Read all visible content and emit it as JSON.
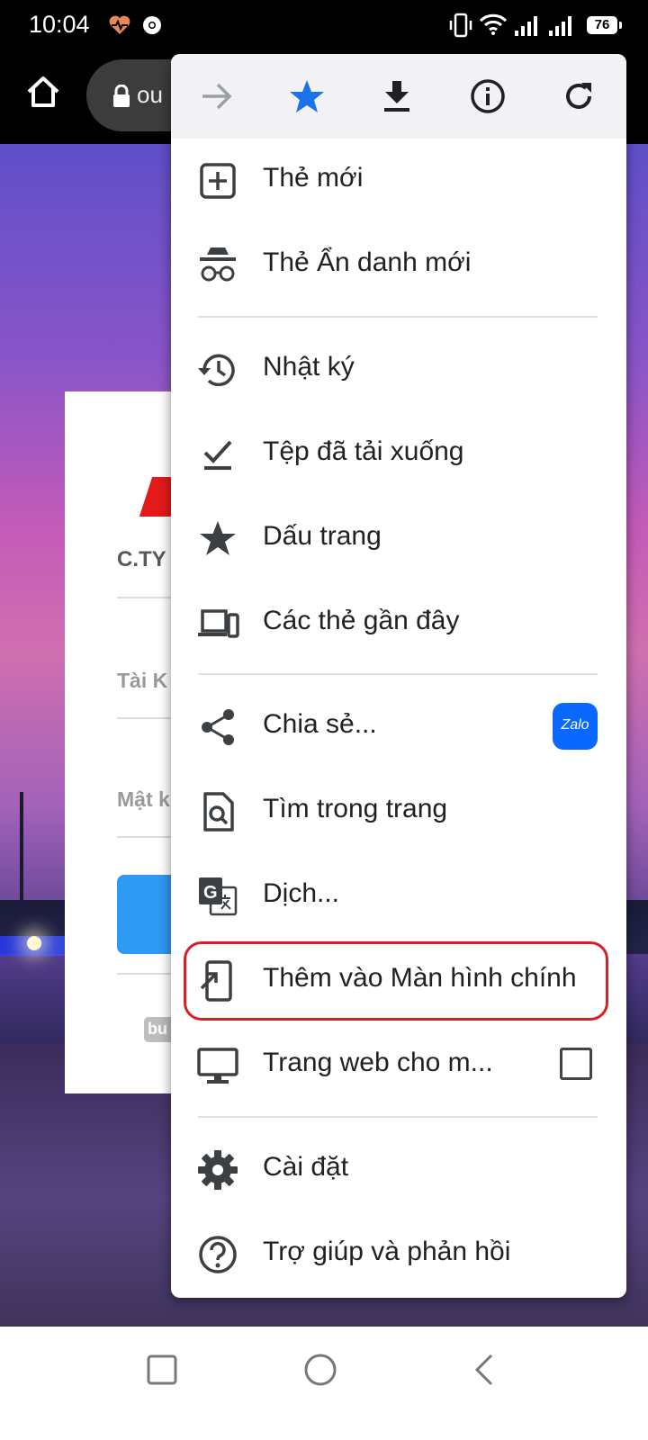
{
  "status_bar": {
    "time": "10:04",
    "battery": "76"
  },
  "toolbar": {
    "url_fragment": "ou"
  },
  "login_card": {
    "company": "C.TY",
    "username_label": "Tài K",
    "password_label": "Mật k",
    "badge_text": "bu"
  },
  "menu": {
    "top_icons": [
      "forward-icon",
      "bookmark-star-icon",
      "download-icon",
      "info-icon",
      "refresh-icon"
    ],
    "items": [
      {
        "label": "Thẻ mới",
        "icon": "new-tab-icon"
      },
      {
        "label": "Thẻ Ẩn danh mới",
        "icon": "incognito-icon"
      },
      {
        "label": "Nhật ký",
        "icon": "history-icon"
      },
      {
        "label": "Tệp đã tải xuống",
        "icon": "downloads-icon"
      },
      {
        "label": "Dấu trang",
        "icon": "bookmarks-icon"
      },
      {
        "label": "Các thẻ gần đây",
        "icon": "recent-tabs-icon"
      },
      {
        "label": "Chia sẻ...",
        "icon": "share-icon",
        "extra": "Zalo"
      },
      {
        "label": "Tìm trong trang",
        "icon": "find-in-page-icon"
      },
      {
        "label": "Dịch...",
        "icon": "translate-icon"
      },
      {
        "label": "Thêm vào Màn hình chính",
        "icon": "add-to-homescreen-icon"
      },
      {
        "label": "Trang web cho m...",
        "icon": "desktop-site-icon"
      },
      {
        "label": "Cài đặt",
        "icon": "settings-icon"
      },
      {
        "label": "Trợ giúp và phản hồi",
        "icon": "help-icon"
      }
    ]
  },
  "colors": {
    "accent": "#1a73e8",
    "highlight": "#d71f26",
    "zalo": "#0a68ff"
  }
}
